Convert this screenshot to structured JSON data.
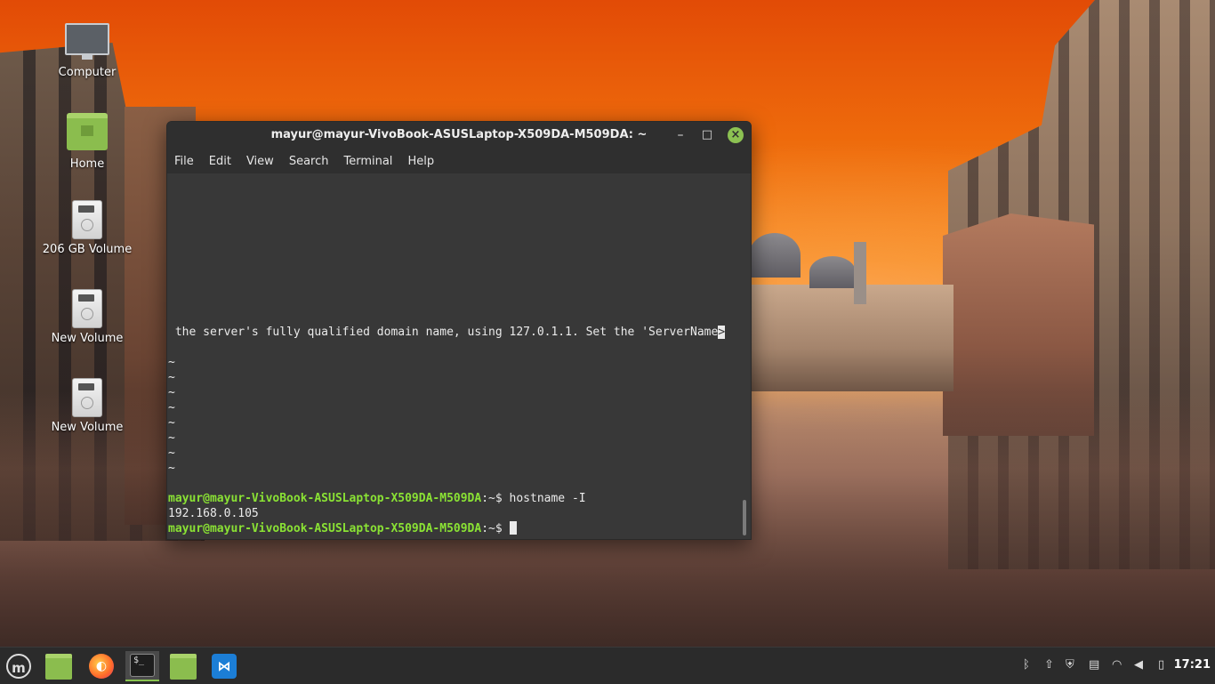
{
  "desktop": {
    "icons": [
      {
        "label": "Computer",
        "icon": "computer-icon"
      },
      {
        "label": "Home",
        "icon": "home-folder-icon"
      },
      {
        "label": "206 GB Volume",
        "icon": "drive-icon"
      },
      {
        "label": "New Volume",
        "icon": "drive-icon"
      },
      {
        "label": "New Volume",
        "icon": "drive-icon"
      }
    ]
  },
  "terminal": {
    "title": "mayur@mayur-VivoBook-ASUSLaptop-X509DA-M509DA: ~",
    "menu": [
      "File",
      "Edit",
      "View",
      "Search",
      "Terminal",
      "Help"
    ],
    "server_line": " the server's fully qualified domain name, using 127.0.1.1. Set the 'ServerName",
    "server_line_end": ">",
    "tilde": "~",
    "prompt_user": "mayur@mayur-VivoBook-ASUSLaptop-X509DA-M509DA",
    "prompt_suffix": ":~$ ",
    "command": "hostname -I",
    "output": "192.168.0.105",
    "close_glyph": "×",
    "min_glyph": "–",
    "max_glyph": "□"
  },
  "taskbar": {
    "clock": "17:21",
    "menu_glyph": "m",
    "terminal_glyph": "$_",
    "vscode_glyph": "⋈",
    "firefox_glyph": "◐",
    "apps": [
      "menu-icon",
      "files-icon",
      "firefox-icon",
      "terminal-icon",
      "files-icon",
      "vscode-icon"
    ],
    "tray_icons": [
      "bluetooth-icon",
      "update-manager-icon",
      "shield-icon",
      "clipboard-icon",
      "wifi-icon",
      "volume-icon",
      "battery-icon"
    ],
    "tray_glyphs": [
      "ᛒ",
      "⇧",
      "⛨",
      "▤",
      "◠",
      "◀",
      "▯"
    ]
  }
}
